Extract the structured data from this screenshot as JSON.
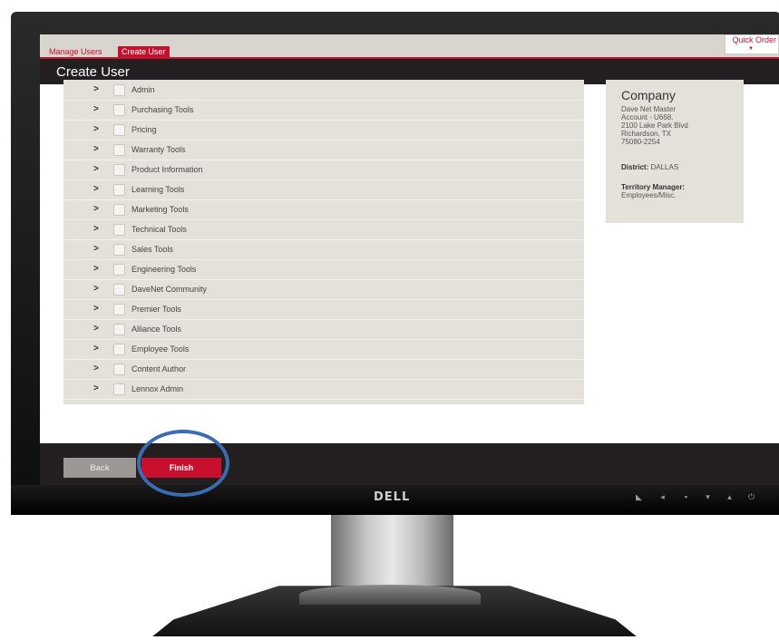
{
  "monitor": {
    "brand": "DELL"
  },
  "tabs": {
    "manage_users": "Manage Users",
    "create_user": "Create User"
  },
  "quick_order": {
    "label": "Quick Order"
  },
  "page": {
    "title": "Create User"
  },
  "permissions": [
    {
      "label": "Admin"
    },
    {
      "label": "Purchasing Tools"
    },
    {
      "label": "Pricing"
    },
    {
      "label": "Warranty Tools"
    },
    {
      "label": "Product Information"
    },
    {
      "label": "Learning Tools"
    },
    {
      "label": "Marketing Tools"
    },
    {
      "label": "Technical Tools"
    },
    {
      "label": "Sales Tools"
    },
    {
      "label": "Engineering Tools"
    },
    {
      "label": "DaveNet Community"
    },
    {
      "label": "Premier Tools"
    },
    {
      "label": "Alliance Tools"
    },
    {
      "label": "Employee Tools"
    },
    {
      "label": "Content Author"
    },
    {
      "label": "Lennox Admin"
    }
  ],
  "company": {
    "heading": "Company",
    "address": "Dave Net Master\nAccount - U668.\n2100 Lake Park Blvd\nRichardson, TX\n75080-2254",
    "district_label": "District:",
    "district_value": "DALLAS",
    "territory_label": "Territory Manager:",
    "territory_value": "Employees/Misc."
  },
  "footer": {
    "back_label": "Back",
    "finish_label": "Finish"
  },
  "colors": {
    "accent": "#c8102e",
    "dark": "#231f20",
    "panel": "#e4e1da",
    "highlight_circle": "#3b6bb0"
  }
}
